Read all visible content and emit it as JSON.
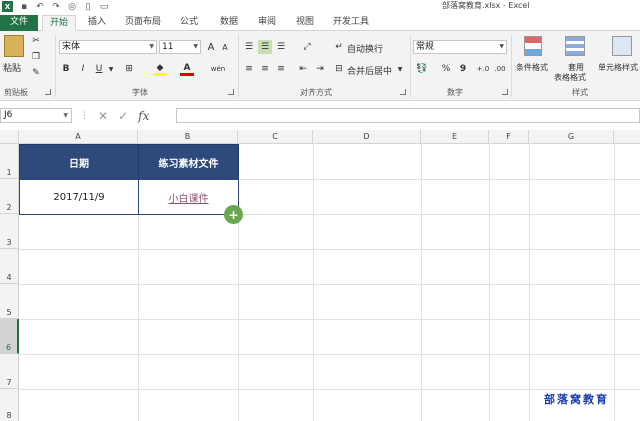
{
  "window": {
    "title": "部落窝教育.xlsx - Excel"
  },
  "ribbon_tabs": [
    "文件",
    "开始",
    "插入",
    "页面布局",
    "公式",
    "数据",
    "审阅",
    "视图",
    "开发工具"
  ],
  "clipboard": {
    "paste_label": "粘贴",
    "group_label": "剪贴板"
  },
  "font": {
    "name": "宋体",
    "size": "11",
    "group_label": "字体",
    "grow": "A",
    "shrink": "A",
    "bold": "B",
    "italic": "I",
    "underline": "U",
    "phonetic": "wén",
    "font_color": "A"
  },
  "alignment": {
    "wrap_label": "自动换行",
    "merge_label": "合并后居中",
    "group_label": "对齐方式"
  },
  "number": {
    "format": "常规",
    "percent": "%",
    "comma": "9",
    "inc_decimal": "+.0",
    "dec_decimal": ".00",
    "group_label": "数字"
  },
  "styles": {
    "conditional_label": "条件格式",
    "table_label_1": "套用",
    "table_label_2": "表格格式",
    "cell_label": "单元格样式",
    "group_label": "样式"
  },
  "formula_bar": {
    "name_box": "J6",
    "fx": "fx",
    "value": ""
  },
  "columns": [
    "A",
    "B",
    "C",
    "D",
    "E",
    "F",
    "G"
  ],
  "rows": [
    "1",
    "2",
    "3",
    "4",
    "5",
    "6",
    "7",
    "8"
  ],
  "selected_row": "6",
  "sheet": {
    "header_a": "日期",
    "header_b": "练习素材文件",
    "date": "2017/11/9",
    "link": "小白课件"
  },
  "watermark": "部落窝教育",
  "colors": {
    "excel_green": "#217346",
    "header_fill": "#2e4a7d",
    "link": "#954f72",
    "watermark": "#1a3ea8"
  }
}
